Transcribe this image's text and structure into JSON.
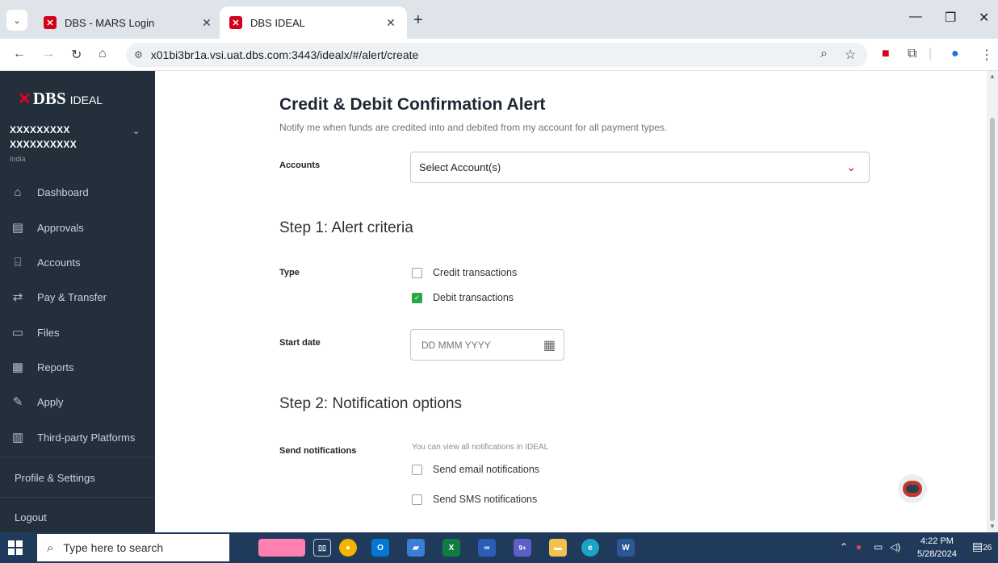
{
  "browser": {
    "tabs": [
      {
        "title": "DBS - MARS Login",
        "favicon": "dbs-x-icon"
      },
      {
        "title": "DBS IDEAL",
        "favicon": "dbs-x-icon"
      }
    ],
    "url": "x01bi3br1a.vsi.uat.dbs.com:3443/idealx/#/alert/create"
  },
  "sidebar": {
    "brand": {
      "x": "✕",
      "dbs": "DBS",
      "ideal": "IDEAL"
    },
    "account": {
      "line1": "XXXXXXXXX",
      "line2": "XXXXXXXXXX",
      "country": "India"
    },
    "items": [
      {
        "label": "Dashboard",
        "icon": "home-icon"
      },
      {
        "label": "Approvals",
        "icon": "approvals-icon"
      },
      {
        "label": "Accounts",
        "icon": "bank-icon"
      },
      {
        "label": "Pay & Transfer",
        "icon": "transfer-icon"
      },
      {
        "label": "Files",
        "icon": "file-icon"
      },
      {
        "label": "Reports",
        "icon": "reports-icon"
      },
      {
        "label": "Apply",
        "icon": "apply-icon"
      },
      {
        "label": "Third-party Platforms",
        "icon": "platforms-icon"
      }
    ],
    "profile_settings": "Profile & Settings",
    "logout": "Logout"
  },
  "main": {
    "title": "Credit & Debit Confirmation Alert",
    "subtitle": "Notify me when funds are credited into and debited from my account for all payment types.",
    "accounts": {
      "label": "Accounts",
      "placeholder": "Select Account(s)"
    },
    "step1": {
      "heading": "Step 1: Alert criteria",
      "type_label": "Type",
      "options": [
        {
          "label": "Credit transactions",
          "checked": false
        },
        {
          "label": "Debit transactions",
          "checked": true
        }
      ],
      "start_date_label": "Start date",
      "start_date_placeholder": "DD MMM YYYY"
    },
    "step2": {
      "heading": "Step 2: Notification options",
      "send_label": "Send notifications",
      "hint": "You can view all notifications in IDEAL",
      "options": [
        {
          "label": "Send email notifications",
          "checked": false
        },
        {
          "label": "Send SMS notifications",
          "checked": false
        }
      ]
    }
  },
  "taskbar": {
    "search_placeholder": "Type here to search",
    "time": "4:22 PM",
    "date": "5/28/2024",
    "notification_count": "26",
    "teams_badge": "9+"
  },
  "colors": {
    "sidebar_bg": "#23303c",
    "brand_red": "#e60023",
    "checkbox_green": "#28a745",
    "taskbar_bg": "#203a5c"
  }
}
